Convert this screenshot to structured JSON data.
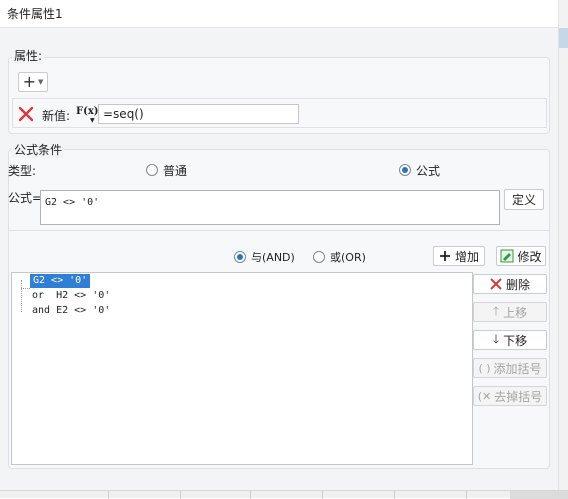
{
  "title": "条件属性1",
  "properties": {
    "group_label": "属性:",
    "add_button": "+",
    "new_value_label": "新值:",
    "formula_icon": "F(x)",
    "value": "=seq()"
  },
  "formula_condition": {
    "group_label": "公式条件",
    "type_label": "类型:",
    "type_options": [
      "普通",
      "公式"
    ],
    "selected_type": "公式",
    "formula_label": "公式=",
    "formula_value": "G2 <> '0'",
    "define_button": "定义"
  },
  "logic": {
    "and_label": "与(AND)",
    "or_label": "或(OR)",
    "selected": "与(AND)",
    "add_button": "增加",
    "modify_button": "修改"
  },
  "conditions": [
    "G2 <> '0'",
    "or  H2 <> '0'",
    "and E2 <> '0'"
  ],
  "side_buttons": {
    "delete": "删除",
    "move_up": "上移",
    "move_down": "下移",
    "add_bracket": "添加括号",
    "remove_bracket": "去掉括号"
  },
  "colors": {
    "selection": "#2f7fd6",
    "delete_red": "#d93a3a",
    "radio_accent": "#2a72c9",
    "modify_green": "#2e9b3a"
  },
  "icons": [
    "close-icon",
    "formula-icon",
    "plus-icon",
    "edit-icon",
    "delete-icon",
    "arrow-up-icon",
    "arrow-down-icon",
    "bracket-add-icon",
    "bracket-remove-icon"
  ]
}
